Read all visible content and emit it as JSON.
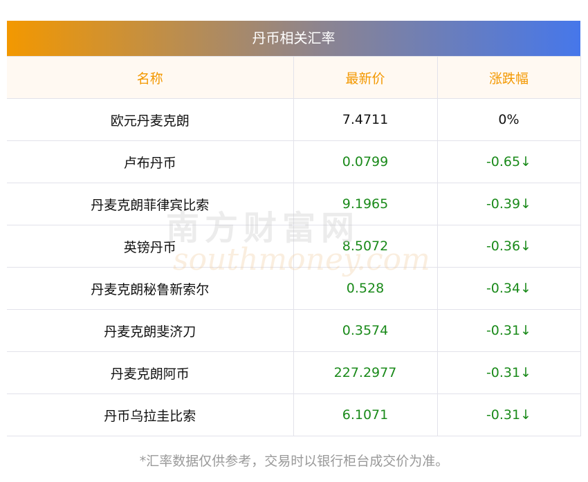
{
  "title": "丹币相关汇率",
  "headers": [
    "名称",
    "最新价",
    "涨跌幅"
  ],
  "rows": [
    {
      "name": "欧元丹麦克朗",
      "price": "7.4711",
      "change": "0%"
    },
    {
      "name": "卢布丹币",
      "price": "0.0799",
      "change": "-0.65↓"
    },
    {
      "name": "丹麦克朗菲律宾比索",
      "price": "9.1965",
      "change": "-0.39↓"
    },
    {
      "name": "英镑丹币",
      "price": "8.5072",
      "change": "-0.36↓"
    },
    {
      "name": "丹麦克朗秘鲁新索尔",
      "price": "0.528",
      "change": "-0.34↓"
    },
    {
      "name": "丹麦克朗斐济刀",
      "price": "0.3574",
      "change": "-0.31↓"
    },
    {
      "name": "丹麦克朗阿币",
      "price": "227.2977",
      "change": "-0.31↓"
    },
    {
      "name": "丹币乌拉圭比索",
      "price": "6.1071",
      "change": "-0.31↓"
    }
  ],
  "watermark": {
    "cn": "南方财富网",
    "en": "southmoney.com"
  },
  "note": "*汇率数据仅供参考，交易时以银行柜台成交价为准。",
  "colors": {
    "header_text": "#f39800",
    "up": "#1a8a1a",
    "down": "#1a8a1a"
  }
}
